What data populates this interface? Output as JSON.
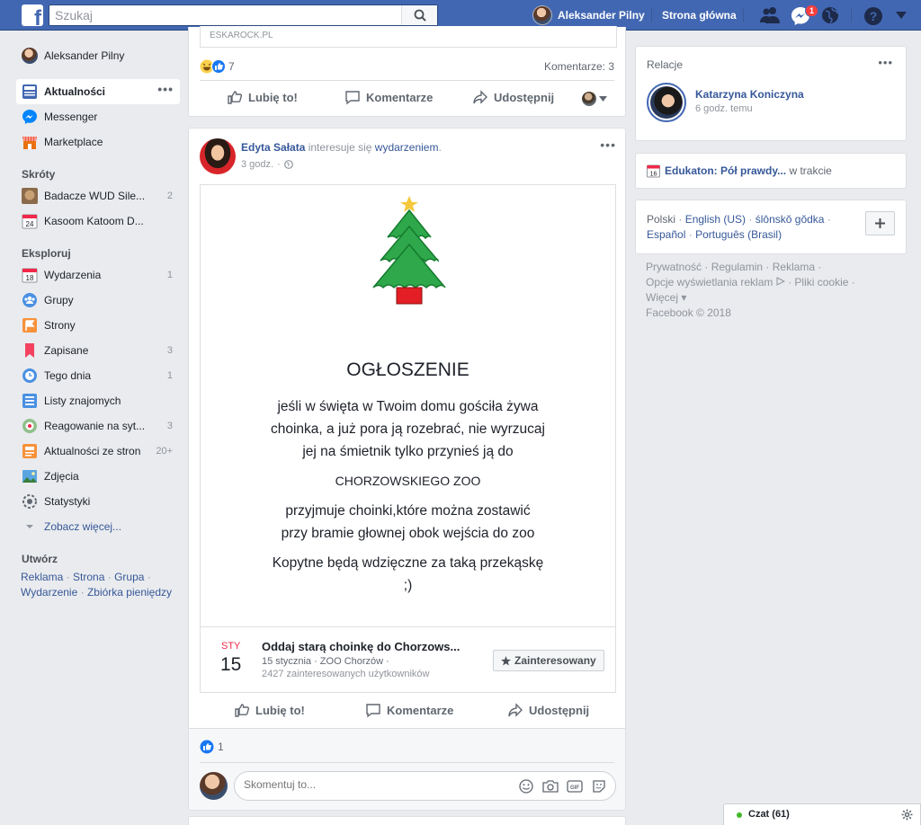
{
  "topbar": {
    "logo": "f",
    "search_placeholder": "Szukaj",
    "user_name": "Aleksander Pilny",
    "home_label": "Strona główna",
    "messenger_badge": "1",
    "icons": [
      "friends-icon",
      "messenger-icon",
      "globe-icon",
      "help-icon",
      "caret-down-icon"
    ]
  },
  "leftnav": {
    "profile_name": "Aleksander Pilny",
    "main_items": [
      {
        "label": "Aktualności",
        "icon": "news-feed-icon",
        "active": true
      },
      {
        "label": "Messenger",
        "icon": "messenger-icon"
      },
      {
        "label": "Marketplace",
        "icon": "marketplace-icon"
      }
    ],
    "shortcuts_heading": "Skróty",
    "shortcuts": [
      {
        "label": "Badacze WUD Sile...",
        "count": "2"
      },
      {
        "label": "Kasoom Katoom D...",
        "count": ""
      }
    ],
    "explore_heading": "Eksploruj",
    "explore": [
      {
        "label": "Wydarzenia",
        "count": "1",
        "icon": "events-icon"
      },
      {
        "label": "Grupy",
        "count": "",
        "icon": "groups-icon"
      },
      {
        "label": "Strony",
        "count": "",
        "icon": "pages-icon"
      },
      {
        "label": "Zapisane",
        "count": "3",
        "icon": "saved-icon"
      },
      {
        "label": "Tego dnia",
        "count": "1",
        "icon": "on-this-day-icon"
      },
      {
        "label": "Listy znajomych",
        "count": "",
        "icon": "friend-lists-icon"
      },
      {
        "label": "Reagowanie na syt...",
        "count": "3",
        "icon": "crisis-response-icon"
      },
      {
        "label": "Aktualności ze stron",
        "count": "20+",
        "icon": "pages-feed-icon"
      },
      {
        "label": "Zdjęcia",
        "count": "",
        "icon": "photos-icon"
      },
      {
        "label": "Statystyki",
        "count": "",
        "icon": "insights-icon"
      }
    ],
    "see_more": "Zobacz więcej...",
    "create_heading": "Utwórz",
    "create_links": [
      "Reklama",
      "Strona",
      "Grupa",
      "Wydarzenie",
      "Zbiórka pieniędzy"
    ]
  },
  "prev_post": {
    "link_domain": "ESKAROCK.PL",
    "reaction_count": "7",
    "comments": "Komentarze: 3",
    "like": "Lubię to!",
    "comment": "Komentarze",
    "share": "Udostępnij"
  },
  "post": {
    "author": "Edyta Sałata",
    "action_text": "interesuje się",
    "action_link": "wydarzeniem",
    "action_suffix": ".",
    "time": "3 godz.",
    "image": {
      "title": "OGŁOSZENIE",
      "lines": [
        "jeśli w święta w Twoim domu gościła żywa",
        "choinka, a już pora ją rozebrać, nie wyrzucaj",
        "jej na śmietnik tylko przynieś ją do",
        "CHORZOWSKIEGO ZOO",
        "przyjmuje choinki,które można zostawić",
        "przy bramie głownej obok wejścia do zoo",
        "Kopytne będą wdzięczne za taką przekąskę",
        ";)"
      ]
    },
    "event": {
      "month": "STY",
      "day": "15",
      "title": "Oddaj starą choinkę do Chorzows...",
      "details": "15 stycznia · ZOO Chorzów ·",
      "interested": "2427 zainteresowanych użytkowników",
      "button": "Zainteresowany"
    },
    "like": "Lubię to!",
    "comment": "Komentarze",
    "share": "Udostępnij",
    "like_count": "1",
    "comment_placeholder": "Skomentuj to..."
  },
  "right": {
    "relations_heading": "Relacje",
    "story_name": "Katarzyna Koniczyna",
    "story_time": "6 godz. temu",
    "event_title": "Edukaton: Pół prawdy...",
    "event_status": "w trakcie",
    "languages": [
      "Polski",
      "English (US)",
      "ślōnskŏ gŏdka",
      "Español",
      "Português (Brasil)"
    ],
    "footer_links": [
      "Prywatność",
      "Regulamin",
      "Reklama",
      "Opcje wyświetlania reklam",
      "Pliki cookie",
      "Więcej"
    ],
    "copyright": "Facebook © 2018"
  },
  "chat": {
    "label": "Czat (61)"
  },
  "colors": {
    "topbar": "#4267b2",
    "link": "#365899",
    "background": "#e9ebee",
    "online": "#42b72a"
  }
}
